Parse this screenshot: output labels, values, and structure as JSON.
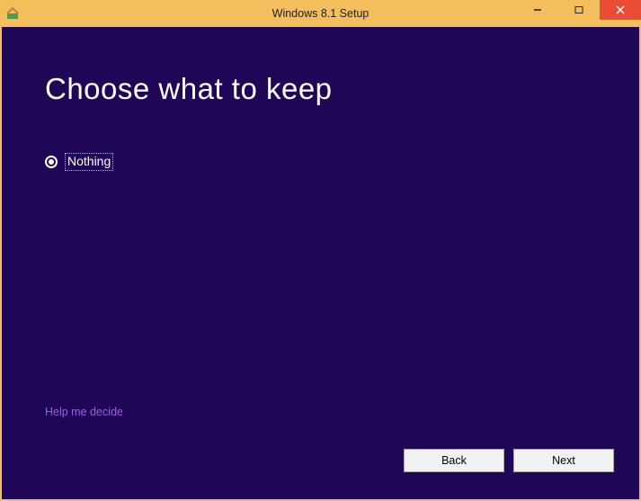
{
  "titlebar": {
    "title": "Windows 8.1 Setup"
  },
  "main": {
    "heading": "Choose what to keep",
    "options": [
      {
        "label": "Nothing",
        "selected": true
      }
    ],
    "help_link": "Help me decide",
    "back_label": "Back",
    "next_label": "Next"
  }
}
